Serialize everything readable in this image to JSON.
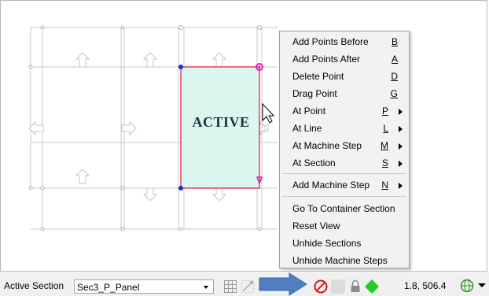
{
  "canvas": {
    "active_label": "ACTIVE"
  },
  "context_menu": {
    "items": [
      {
        "label": "Add Points Before",
        "accel": "B",
        "submenu": false
      },
      {
        "label": "Add Points After",
        "accel": "A",
        "submenu": false
      },
      {
        "label": "Delete Point",
        "accel": "D",
        "submenu": false
      },
      {
        "label": "Drag Point",
        "accel": "G",
        "submenu": false
      },
      {
        "label": "At Point",
        "accel": "P",
        "submenu": true
      },
      {
        "label": "At Line",
        "accel": "L",
        "submenu": true
      },
      {
        "label": "At Machine Step",
        "accel": "M",
        "submenu": true
      },
      {
        "label": "At Section",
        "accel": "S",
        "submenu": true
      },
      {
        "label": "Add Machine Step",
        "accel": "N",
        "submenu": true
      },
      {
        "label": "Go To Container Section",
        "accel": "",
        "submenu": false
      },
      {
        "label": "Reset View",
        "accel": "",
        "submenu": false
      },
      {
        "label": "Unhide Sections",
        "accel": "",
        "submenu": false
      },
      {
        "label": "Unhide Machine Steps",
        "accel": "",
        "submenu": false
      }
    ]
  },
  "status_bar": {
    "active_section_label": "Active Section",
    "active_section_value": "Sec3_P_Panel",
    "coordinates": "1.8, 506.4"
  },
  "colors": {
    "active_fill": "#d9f7ef",
    "active_border": "#e0103a",
    "vertex_blue": "#1a2fd0",
    "vertex_magenta": "#e020c0",
    "arrow_blue": "#4f7fbf",
    "no_icon_red": "#e01010",
    "diamond_green": "#22cc22"
  }
}
